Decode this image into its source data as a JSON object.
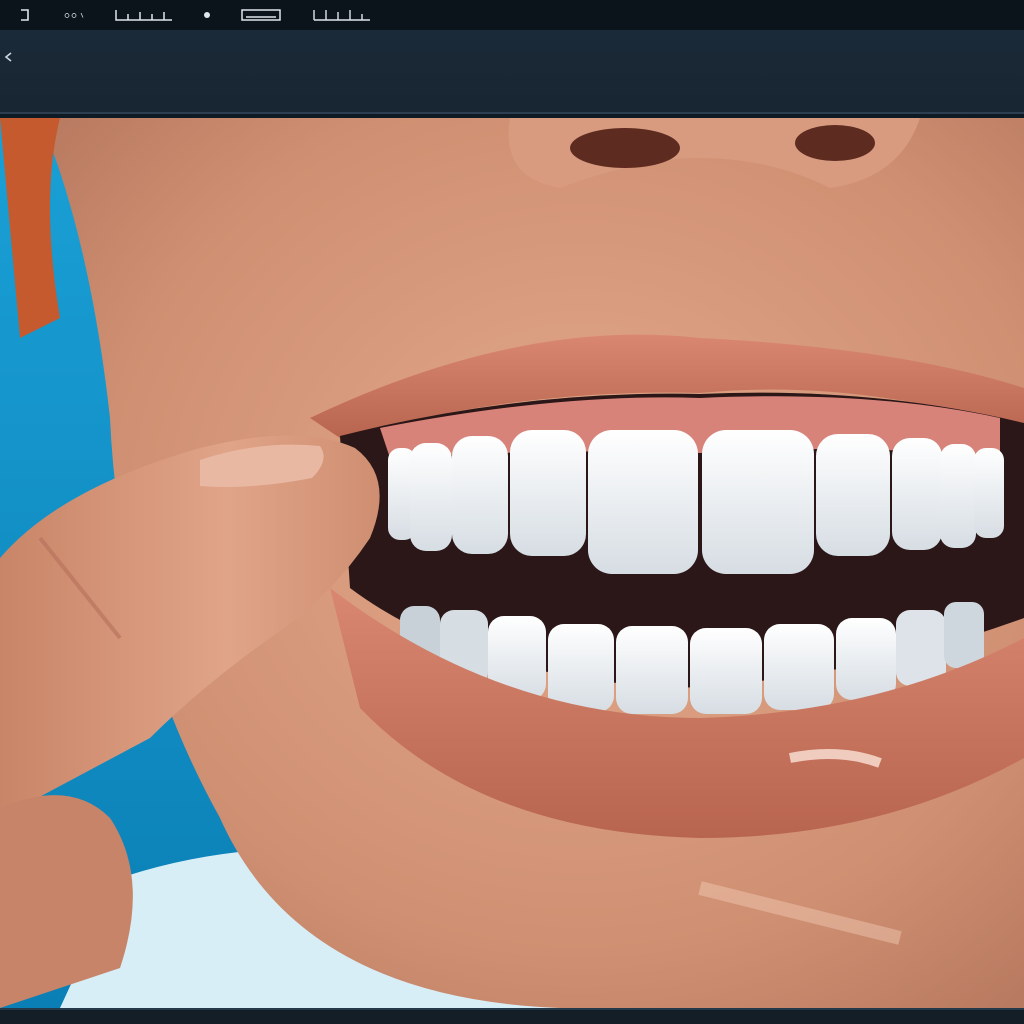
{
  "window": {
    "toolbar_icons": [
      "settings-icon",
      "zoom-icon",
      "timeline-icon",
      "dot-icon",
      "screen-icon",
      "grid-icon"
    ]
  },
  "viewer": {
    "image_subject": "closeup-smile-render"
  },
  "colors": {
    "topbar": "#0b141b",
    "subbar": "#1b2a38",
    "backdrop": "#1fa3d6",
    "skin": "#d79a7c",
    "lip": "#c9765f",
    "teeth": "#f1f3f4",
    "gum": "#d8837a"
  }
}
